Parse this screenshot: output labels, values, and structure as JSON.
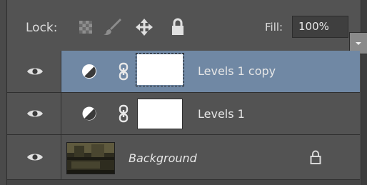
{
  "lock_bar": {
    "lock_label": "Lock:",
    "fill_label": "Fill:",
    "fill_value": "100%"
  },
  "layers": [
    {
      "name": "Levels 1 copy",
      "selected": true,
      "type": "adjustment"
    },
    {
      "name": "Levels 1",
      "selected": false,
      "type": "adjustment"
    },
    {
      "name": "Background",
      "selected": false,
      "type": "image",
      "locked": true
    }
  ],
  "icons": {
    "lock_transparent": "checkerboard-icon",
    "lock_image": "brush-icon",
    "lock_position": "move-icon",
    "lock_all": "lock-icon",
    "visibility": "eye-icon",
    "adjustment": "levels-adjustment-icon",
    "link": "chain-link-icon"
  },
  "colors": {
    "panel_bg": "#535353",
    "selected_row": "#7088a4",
    "text": "#e6e6e6"
  }
}
